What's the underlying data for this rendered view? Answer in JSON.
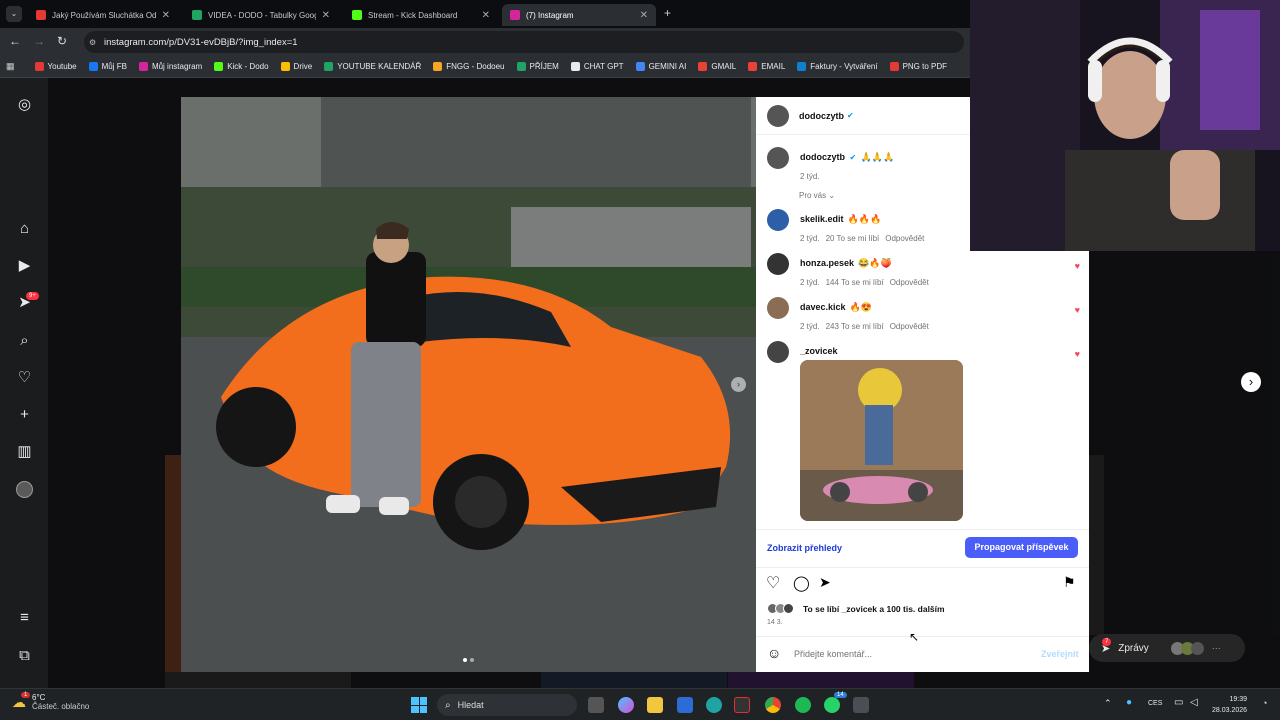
{
  "tabs": [
    {
      "title": "Jaký Používám Sluchátka Od Sa",
      "color": "#e53935"
    },
    {
      "title": "VIDEA - DODO - Tabulky Googl",
      "color": "#1fa463"
    },
    {
      "title": "Stream - Kick Dashboard",
      "color": "#53fc18"
    },
    {
      "title": "(7) Instagram",
      "color": "#d6249f"
    }
  ],
  "url": "instagram.com/p/DV31-evDBjB/?img_index=1",
  "bookmarks": [
    {
      "label": "Youtube",
      "color": "#e53935"
    },
    {
      "label": "Můj FB",
      "color": "#1877f2"
    },
    {
      "label": "Můj instagram",
      "color": "#d6249f"
    },
    {
      "label": "Kick - Dodo",
      "color": "#53fc18"
    },
    {
      "label": "Drive",
      "color": "#fbbc04"
    },
    {
      "label": "YOUTUBE KALENDÁŘ",
      "color": "#1fa463"
    },
    {
      "label": "FNGG - Dodoeu",
      "color": "#f5a623"
    },
    {
      "label": "PŘÍJEM",
      "color": "#1fa463"
    },
    {
      "label": "CHAT GPT",
      "color": "#e8eaed"
    },
    {
      "label": "GEMINI AI",
      "color": "#4285f4"
    },
    {
      "label": "GMAIL",
      "color": "#ea4335"
    },
    {
      "label": "EMAIL",
      "color": "#ea4335"
    },
    {
      "label": "Faktury - Vytváření",
      "color": "#0f7fd1"
    },
    {
      "label": "PNG to PDF",
      "color": "#e53935"
    }
  ],
  "sidebar_badge": "9+",
  "post": {
    "author": "dodoczytb",
    "caption_user": "dodoczytb",
    "caption_text": "🙏🙏🙏",
    "caption_time": "2 týd.",
    "sort_label": "Pro vás",
    "comments": [
      {
        "user": "skelik.edit",
        "text": "🔥🔥🔥",
        "time": "2 týd.",
        "likes": "20 To se mi líbí",
        "reply": "Odpovědět",
        "avatar_color": "#2c5fa8",
        "liked": false
      },
      {
        "user": "honza.pesek",
        "text": "😂🔥🍑",
        "time": "2 týd.",
        "likes": "144 To se mi líbí",
        "reply": "Odpovědět",
        "avatar_color": "#333333",
        "liked": true
      },
      {
        "user": "davec.kick",
        "text": "🔥😍",
        "time": "2 týd.",
        "likes": "243 To se mi líbí",
        "reply": "Odpovědět",
        "avatar_color": "#8a6d55",
        "liked": true
      },
      {
        "user": "_zovicek",
        "text": "",
        "time": "",
        "likes": "",
        "reply": "",
        "avatar_color": "#444444",
        "liked": true
      }
    ],
    "insights_label": "Zobrazit přehledy",
    "promote_label": "Propagovat příspěvek",
    "likes_text": "To se líbí _zovicek a 100 tis. dalším",
    "date": "14 3.",
    "comment_placeholder": "Přidejte komentář...",
    "publish_label": "Zveřejnit"
  },
  "messages_label": "Zprávy",
  "messages_badge": "7",
  "taskbar": {
    "weather_temp": "6°C",
    "weather_desc": "Částeč. oblačno",
    "weather_badge": "1",
    "search_label": "Hledat",
    "lang": "CES",
    "time": "19:39",
    "date": "28.03.2026",
    "whatsapp_badge": "14"
  },
  "colors": {
    "accent": "#0095f6",
    "promote": "#4a5df9",
    "heart": "#ed4956"
  }
}
